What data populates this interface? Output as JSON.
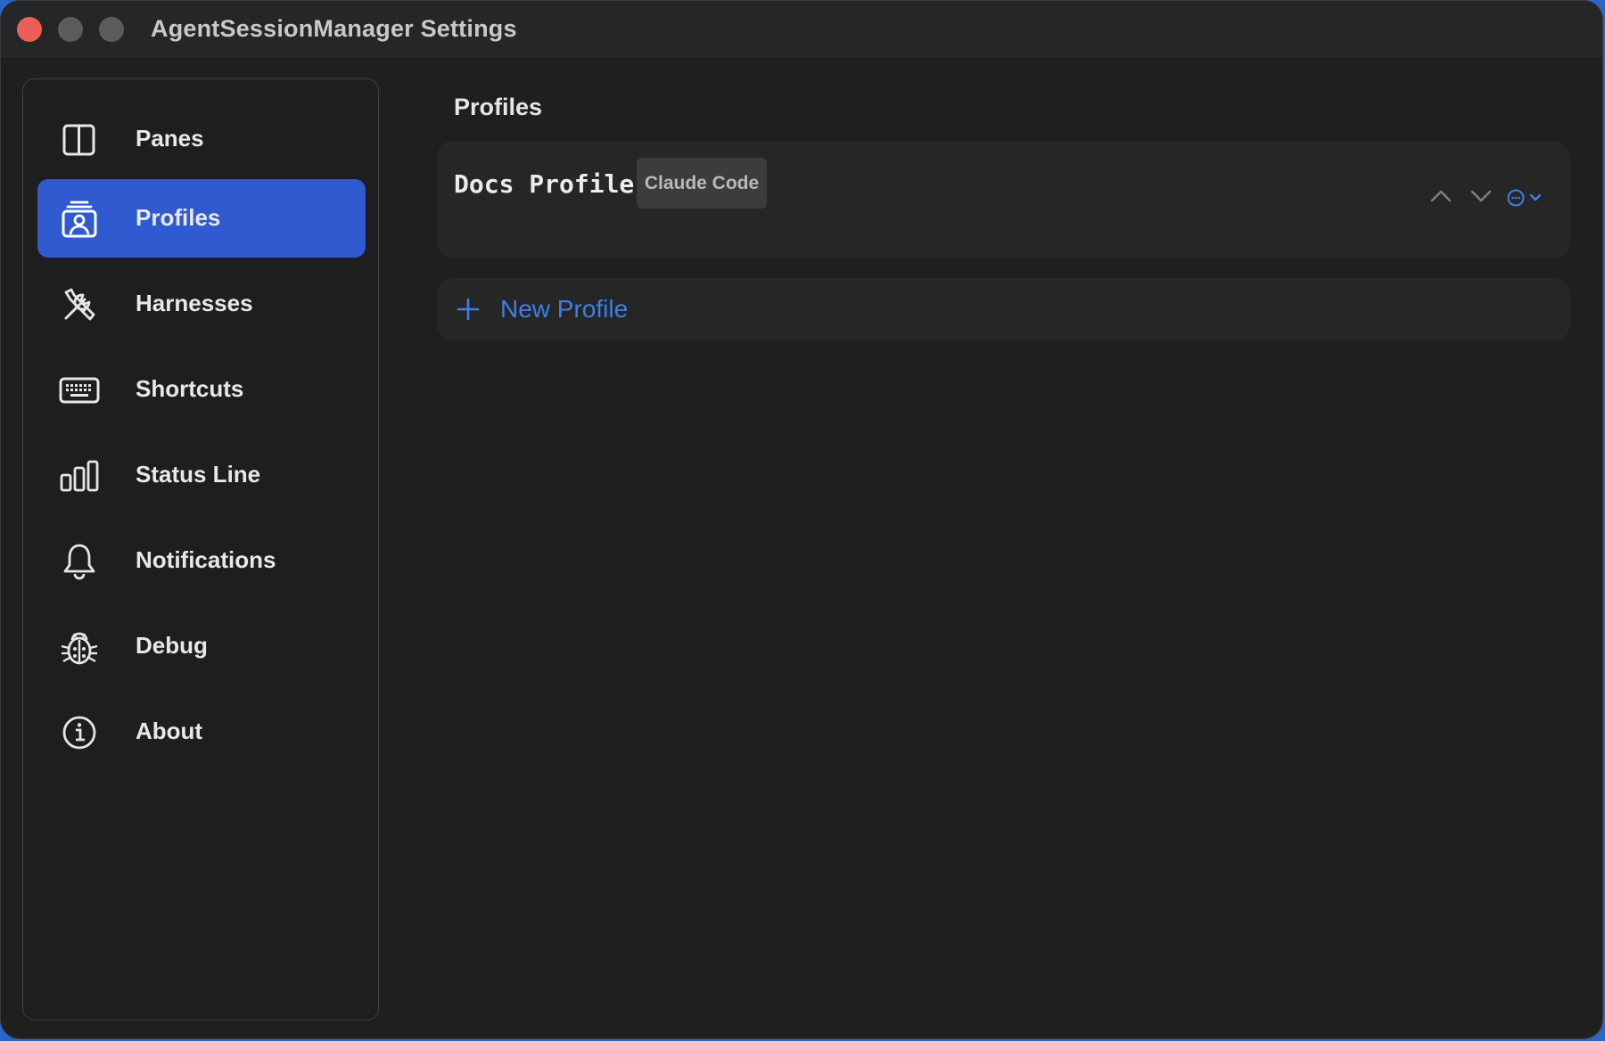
{
  "window": {
    "title": "AgentSessionManager Settings"
  },
  "sidebar": {
    "items": [
      {
        "label": "Panes",
        "icon": "panes-icon",
        "selected": false
      },
      {
        "label": "Profiles",
        "icon": "profiles-icon",
        "selected": true
      },
      {
        "label": "Harnesses",
        "icon": "tools-icon",
        "selected": false
      },
      {
        "label": "Shortcuts",
        "icon": "keyboard-icon",
        "selected": false
      },
      {
        "label": "Status Line",
        "icon": "status-bars-icon",
        "selected": false
      },
      {
        "label": "Notifications",
        "icon": "bell-icon",
        "selected": false
      },
      {
        "label": "Debug",
        "icon": "ladybug-icon",
        "selected": false
      },
      {
        "label": "About",
        "icon": "info-icon",
        "selected": false
      }
    ]
  },
  "main": {
    "section_title": "Profiles",
    "profiles": [
      {
        "name": "Docs Profile",
        "harness": "Claude Code"
      }
    ],
    "new_profile_label": "New Profile"
  },
  "colors": {
    "accent": "#2f5ad0",
    "link": "#3f7ee8",
    "background": "#1f1f1f",
    "card": "#262626",
    "close": "#ec5f57"
  }
}
